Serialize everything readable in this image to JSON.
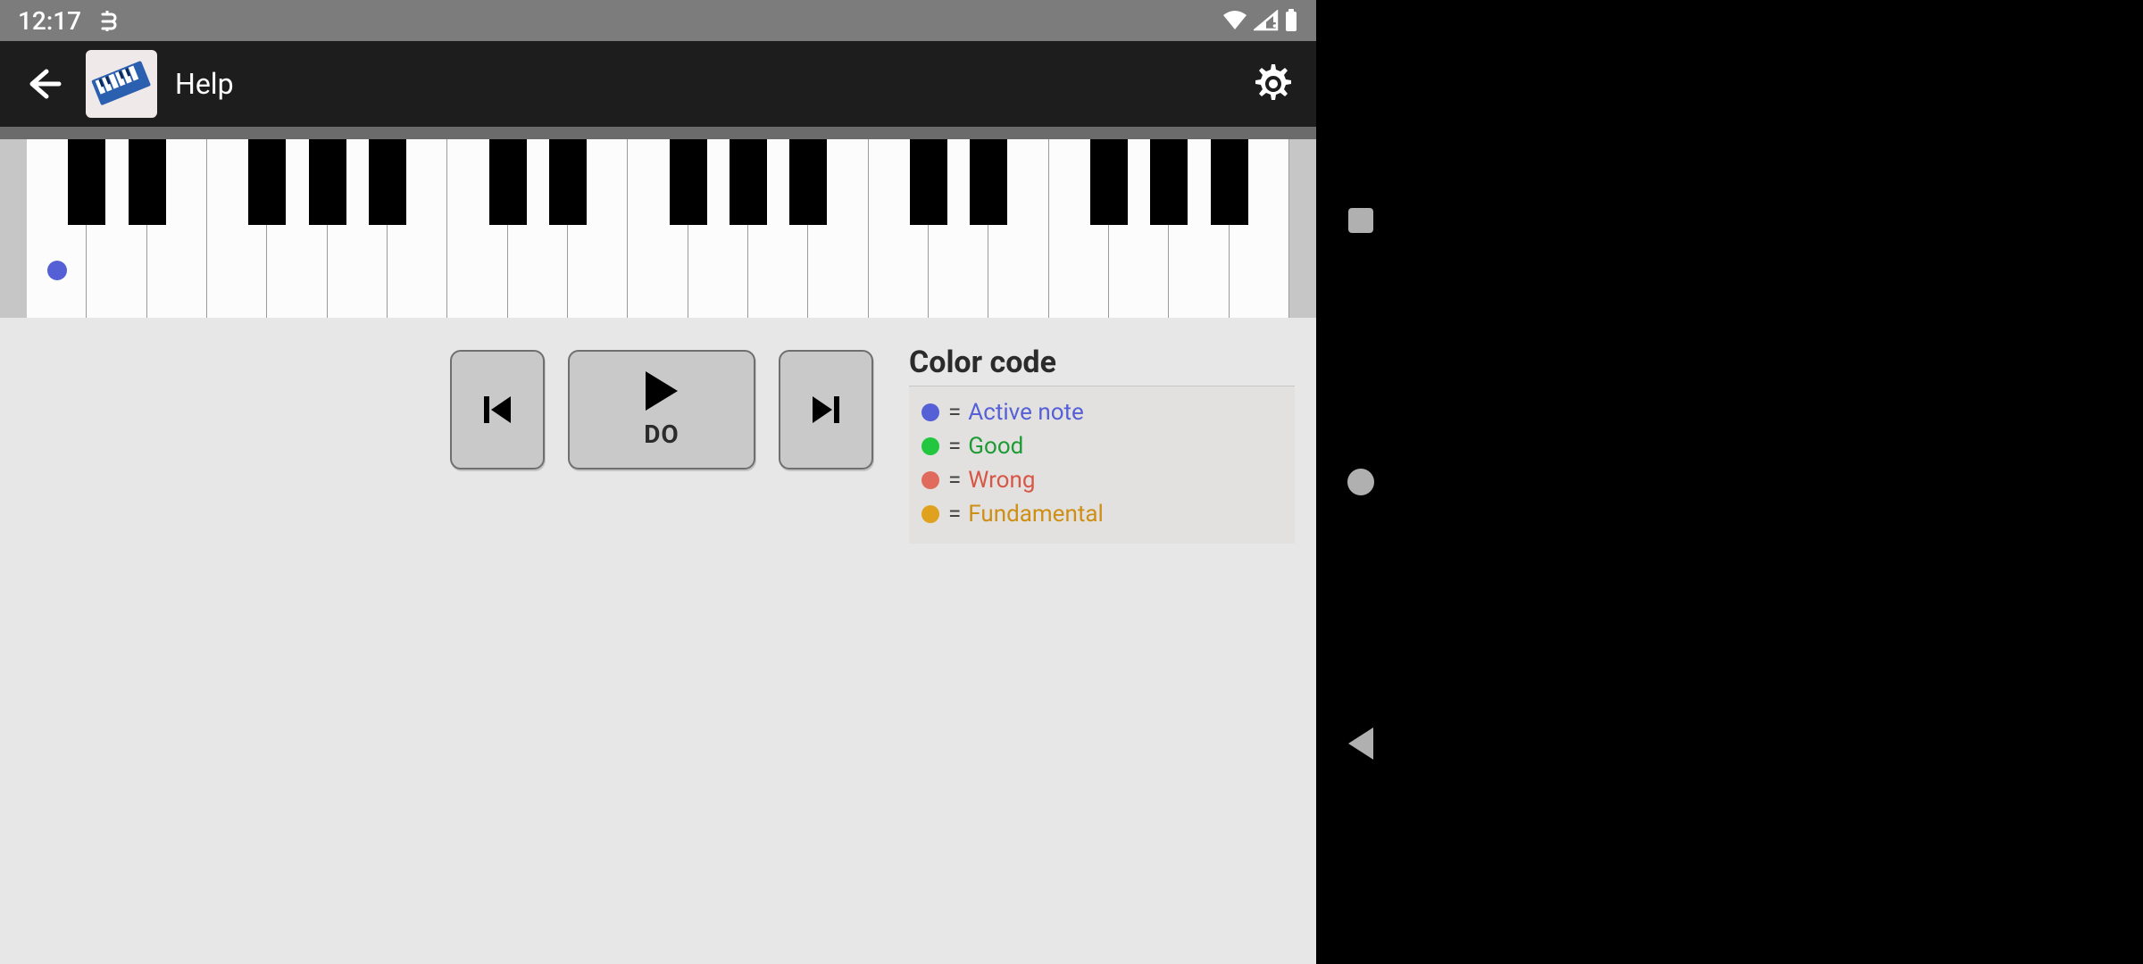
{
  "status": {
    "time": "12:17"
  },
  "appbar": {
    "title": "Help"
  },
  "piano": {
    "white_keys": 21,
    "black_key_positions": [
      0,
      1,
      3,
      4,
      5,
      7,
      8,
      10,
      11,
      12,
      14,
      15,
      17,
      18,
      19
    ],
    "active_note_index": 0
  },
  "controls": {
    "play_note_label": "DO"
  },
  "legend": {
    "title": "Color code",
    "items": [
      {
        "color": "#5560d6",
        "text_color": "#5560d6",
        "label": "Active note"
      },
      {
        "color": "#23c63f",
        "text_color": "#1e9b34",
        "label": "Good"
      },
      {
        "color": "#e06a5b",
        "text_color": "#d85646",
        "label": "Wrong"
      },
      {
        "color": "#e0a21e",
        "text_color": "#cf8f14",
        "label": "Fundamental"
      }
    ]
  }
}
